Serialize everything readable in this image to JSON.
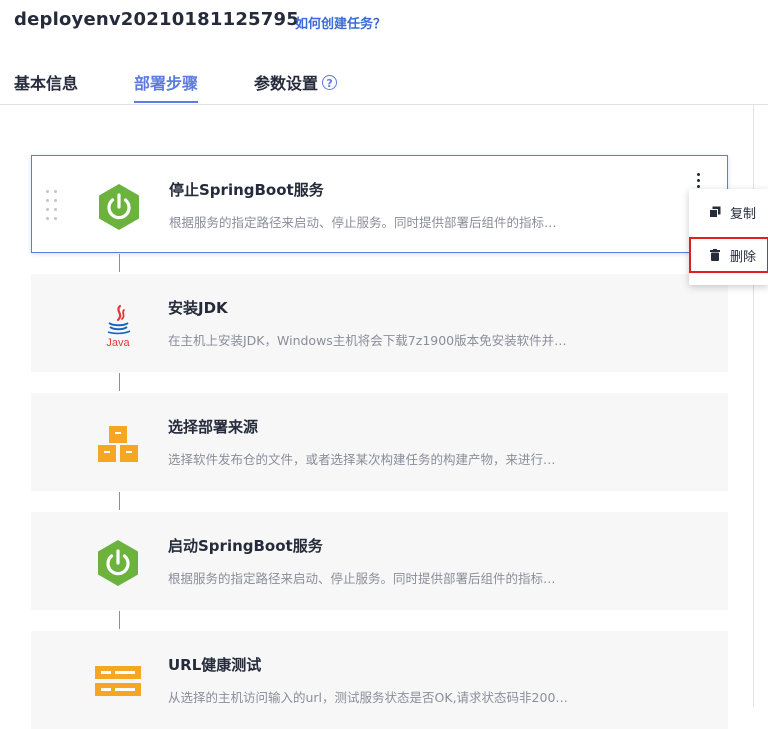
{
  "header": {
    "task_name": "deployenv20210181125795",
    "help_link": "如何创建任务？"
  },
  "tabs": [
    {
      "label": "基本信息",
      "active": false
    },
    {
      "label": "部署步骤",
      "active": true
    },
    {
      "label": "参数设置",
      "active": false,
      "help_icon": "question-circle-icon"
    }
  ],
  "steps": [
    {
      "title": "停止SpringBoot服务",
      "desc": "根据服务的指定路径来启动、停止服务。同时提供部署后组件的指标…",
      "icon": "springboot-power-icon",
      "selected": true
    },
    {
      "title": "安装JDK",
      "desc": "在主机上安装JDK，Windows主机将会下载7z1900版本免安装软件并…",
      "icon": "java-icon",
      "icon_text": "Java"
    },
    {
      "title": "选择部署来源",
      "desc": "选择软件发布仓的文件，或者选择某次构建任务的构建产物，来进行…",
      "icon": "package-boxes-icon"
    },
    {
      "title": "启动SpringBoot服务",
      "desc": "根据服务的指定路径来启动、停止服务。同时提供部署后组件的指标…",
      "icon": "springboot-power-icon"
    },
    {
      "title": "URL健康测试",
      "desc": "从选择的主机访问输入的url，测试服务状态是否OK,请求状态码非200…",
      "icon": "server-rack-icon"
    }
  ],
  "context_menu": {
    "items": [
      {
        "label": "复制",
        "icon": "copy-icon"
      },
      {
        "label": "删除",
        "icon": "trash-icon",
        "highlighted": true
      }
    ]
  },
  "colors": {
    "accent": "#5e7ce0",
    "springboot_green": "#6cb33e",
    "java_red": "#e53935",
    "java_blue": "#1565c0",
    "package_yellow": "#f5a623",
    "highlight_red": "#e02020"
  }
}
